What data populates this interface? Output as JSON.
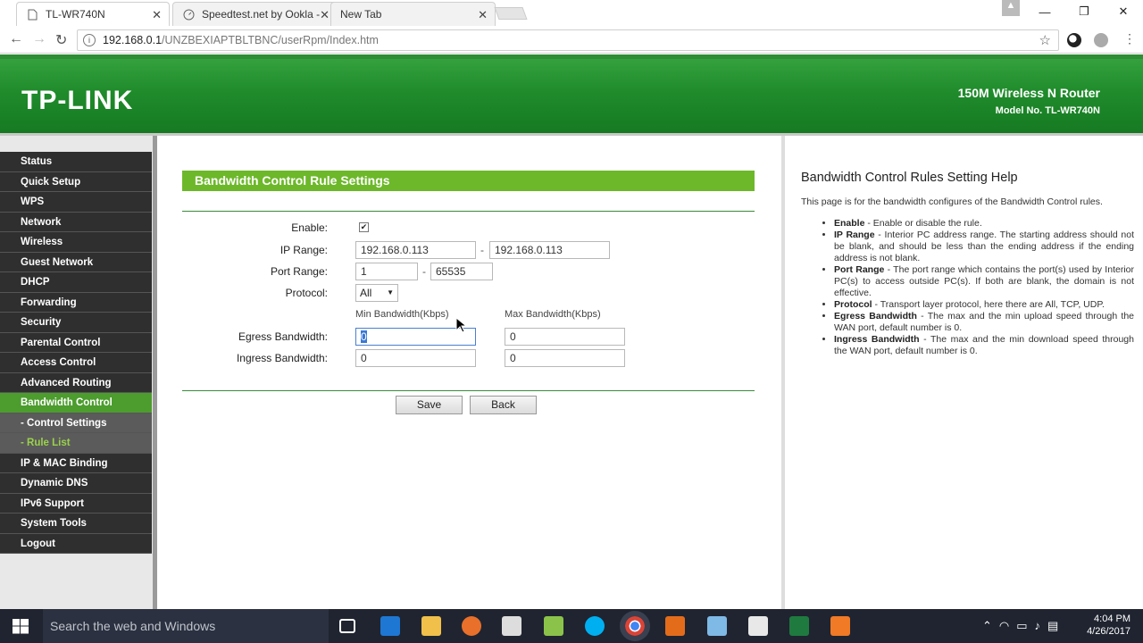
{
  "browser": {
    "tabs": [
      {
        "title": "TL-WR740N"
      },
      {
        "title": "Speedtest.net by Ookla -"
      },
      {
        "title": "New Tab"
      }
    ],
    "url_host": "192.168.0.1",
    "url_path": "/UNZBEXIAPTBLTBNC/userRpm/Index.htm"
  },
  "router_header": {
    "logo": "TP-LINK",
    "product_name": "150M Wireless N Router",
    "model": "Model No. TL-WR740N"
  },
  "sidebar": {
    "items": [
      {
        "label": "Status"
      },
      {
        "label": "Quick Setup"
      },
      {
        "label": "WPS"
      },
      {
        "label": "Network"
      },
      {
        "label": "Wireless"
      },
      {
        "label": "Guest Network"
      },
      {
        "label": "DHCP"
      },
      {
        "label": "Forwarding"
      },
      {
        "label": "Security"
      },
      {
        "label": "Parental Control"
      },
      {
        "label": "Access Control"
      },
      {
        "label": "Advanced Routing"
      },
      {
        "label": "Bandwidth Control"
      },
      {
        "label": "- Control Settings"
      },
      {
        "label": "- Rule List"
      },
      {
        "label": "IP & MAC Binding"
      },
      {
        "label": "Dynamic DNS"
      },
      {
        "label": "IPv6 Support"
      },
      {
        "label": "System Tools"
      },
      {
        "label": "Logout"
      }
    ]
  },
  "form": {
    "title": "Bandwidth Control Rule Settings",
    "enable_label": "Enable:",
    "enable_checked": true,
    "ip_range_label": "IP Range:",
    "ip_start": "192.168.0.113",
    "ip_end": "192.168.0.113",
    "port_range_label": "Port Range:",
    "port_start": "1",
    "port_end": "65535",
    "protocol_label": "Protocol:",
    "protocol_value": "All",
    "min_bw_header": "Min Bandwidth(Kbps)",
    "max_bw_header": "Max Bandwidth(Kbps)",
    "egress_label": "Egress Bandwidth:",
    "egress_min": "0",
    "egress_max": "0",
    "ingress_label": "Ingress Bandwidth:",
    "ingress_min": "0",
    "ingress_max": "0",
    "dash": "-",
    "save_label": "Save",
    "back_label": "Back"
  },
  "help": {
    "title": "Bandwidth Control Rules Setting Help",
    "intro": "This page is for the bandwidth configures of the Bandwidth Control rules.",
    "items": [
      {
        "term": "Enable",
        "desc": " - Enable or disable the rule."
      },
      {
        "term": "IP Range",
        "desc": " - Interior PC address range. The starting address should not be blank, and should be less than the ending address if the ending address is not blank."
      },
      {
        "term": "Port Range",
        "desc": " - The port range which contains the port(s) used by Interior PC(s) to access outside PC(s). If both are blank, the domain is not effective."
      },
      {
        "term": "Protocol",
        "desc": " - Transport layer protocol, here there are All, TCP, UDP."
      },
      {
        "term": "Egress Bandwidth",
        "desc": " - The max and the min upload speed through the WAN port, default number is 0."
      },
      {
        "term": "Ingress Bandwidth",
        "desc": " - The max and the min download speed through the WAN port, default number is 0."
      }
    ]
  },
  "taskbar": {
    "search_placeholder": "Search the web and Windows",
    "time": "4:04 PM",
    "date": "4/26/2017"
  },
  "colors": {
    "brand_green": "#2a9a35",
    "menu_active": "#4c9c2e",
    "section_header": "#6db82a"
  }
}
